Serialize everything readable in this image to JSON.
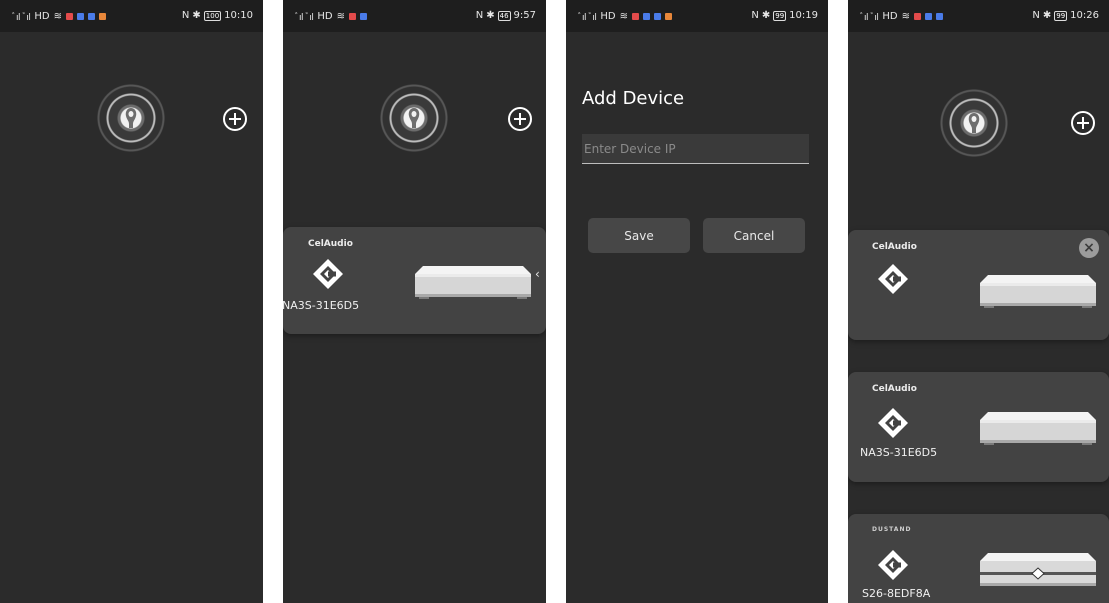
{
  "screens": [
    {
      "status": {
        "signal": "ﾞıl ﾞıl",
        "wifi": "≋",
        "network": "HD",
        "battery": "100",
        "time": "10:10"
      }
    },
    {
      "status": {
        "signal": "ﾞıl ﾞıl",
        "wifi": "≋",
        "network": "HD",
        "battery": "46",
        "time": "9:57"
      },
      "device": {
        "brand": "CelAudio",
        "name": "NA3S-31E6D5"
      }
    },
    {
      "status": {
        "signal": "ﾞıl ﾞıl",
        "wifi": "≋",
        "network": "HD",
        "battery": "99",
        "time": "10:19"
      },
      "dialog": {
        "title": "Add Device",
        "placeholder": "Enter Device IP",
        "save_label": "Save",
        "cancel_label": "Cancel"
      }
    },
    {
      "status": {
        "signal": "ﾞıl ﾞıl",
        "wifi": "≋",
        "network": "HD",
        "battery": "99",
        "time": "10:26"
      },
      "devices": [
        {
          "brand": "CelAudio",
          "name": ""
        },
        {
          "brand": "CelAudio",
          "name": "NA3S-31E6D5"
        },
        {
          "brand": "DUSTAND",
          "name": "S26-8EDF8A"
        }
      ]
    }
  ],
  "colors": {
    "background": "#2b2b2b",
    "card": "#434343",
    "status_bar": "#1e1e1e"
  },
  "icons": [
    "locator-icon",
    "add-circle-icon",
    "brand-logo-icon",
    "close-icon",
    "chevron-left-icon"
  ]
}
